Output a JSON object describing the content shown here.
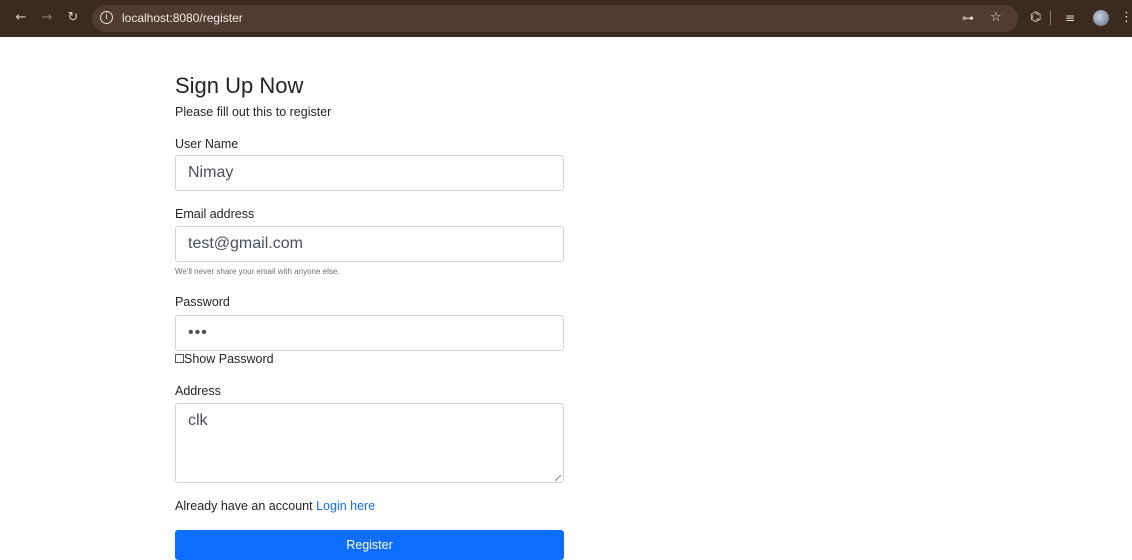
{
  "browser": {
    "url": "localhost:8080/register"
  },
  "form": {
    "title": "Sign Up Now",
    "subtitle": "Please fill out this to register",
    "username": {
      "label": "User Name",
      "value": "Nimay"
    },
    "email": {
      "label": "Email address",
      "value": "test@gmail.com",
      "help": "We'll never share your email with anyone else."
    },
    "password": {
      "label": "Password",
      "value": "•••"
    },
    "show_password_label": "Show Password",
    "address": {
      "label": "Address",
      "value": "clk"
    },
    "login_prompt": "Already have an account ",
    "login_link": "Login here",
    "register_label": "Register"
  },
  "colors": {
    "toolbar": "#3b2a22",
    "primary": "#0d6efd"
  },
  "icons": {
    "back": "arrow-left-icon",
    "forward": "arrow-right-icon",
    "reload": "reload-icon",
    "info": "info-icon",
    "password_key": "key-icon",
    "bookmark": "star-icon",
    "extensions": "puzzle-icon",
    "reading_list": "reading-list-icon",
    "profile": "avatar",
    "menu": "kebab-menu-icon"
  }
}
